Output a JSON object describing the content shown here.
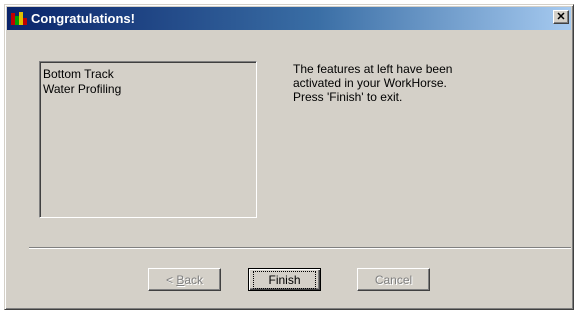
{
  "window": {
    "title": "Congratulations!",
    "icon": "app-icon",
    "close_label": "✕"
  },
  "features_list": {
    "items": [
      {
        "label": "Bottom Track"
      },
      {
        "label": "Water Profiling"
      }
    ]
  },
  "message": {
    "line1": "The features at left have been",
    "line2": "activated in your WorkHorse.",
    "line3": "Press 'Finish' to exit."
  },
  "buttons": {
    "back_prefix": "< ",
    "back_mnemonic": "B",
    "back_rest": "ack",
    "finish_label": "Finish",
    "cancel_label": "Cancel"
  },
  "colors": {
    "face": "#d4d0c8",
    "title_start": "#0a246a",
    "title_end": "#a6caf0"
  }
}
